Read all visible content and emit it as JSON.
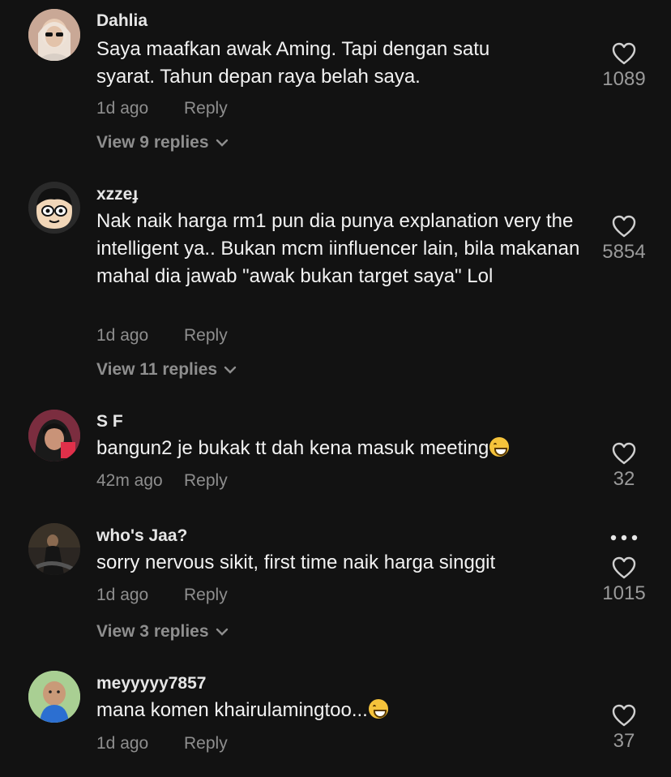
{
  "comments": [
    {
      "username": "Dahlia",
      "text": "Saya maafkan awak Aming. Tapi dengan satu syarat. Tahun depan raya belah saya.",
      "time": "1d ago",
      "reply_label": "Reply",
      "likes": "1089",
      "view_replies": "View 9 replies"
    },
    {
      "username": "xzzeɟ",
      "text": "Nak naik harga rm1 pun dia punya explanation very the intelligent ya.. Bukan mcm iinfluencer lain, bila makanan mahal dia jawab \"awak bukan target saya\" Lol",
      "time": "1d ago",
      "reply_label": "Reply",
      "likes": "5854",
      "view_replies": "View 11 replies"
    },
    {
      "username": "S F",
      "text": "bangun2 je bukak tt dah kena masuk meeting",
      "time": "42m ago",
      "reply_label": "Reply",
      "likes": "32"
    },
    {
      "username": "who's Jaa?",
      "text": "sorry nervous sikit, first time naik harga singgit",
      "time": "1d ago",
      "reply_label": "Reply",
      "likes": "1015",
      "view_replies": "View 3 replies"
    },
    {
      "username": "meyyyyy7857",
      "text": "mana komen khairulamingtoo...",
      "time": "1d ago",
      "reply_label": "Reply",
      "likes": "37"
    }
  ],
  "icons": {
    "like": "heart-outline-icon",
    "expand": "chevron-down-icon",
    "more": "more-horizontal-icon",
    "emoji_1": "laughing-tears-emoji",
    "emoji_2": "grinning-emoji"
  },
  "colors": {
    "background": "#121212",
    "secondary_text": "#8e8e8e",
    "primary_text": "#f2f2f2"
  }
}
